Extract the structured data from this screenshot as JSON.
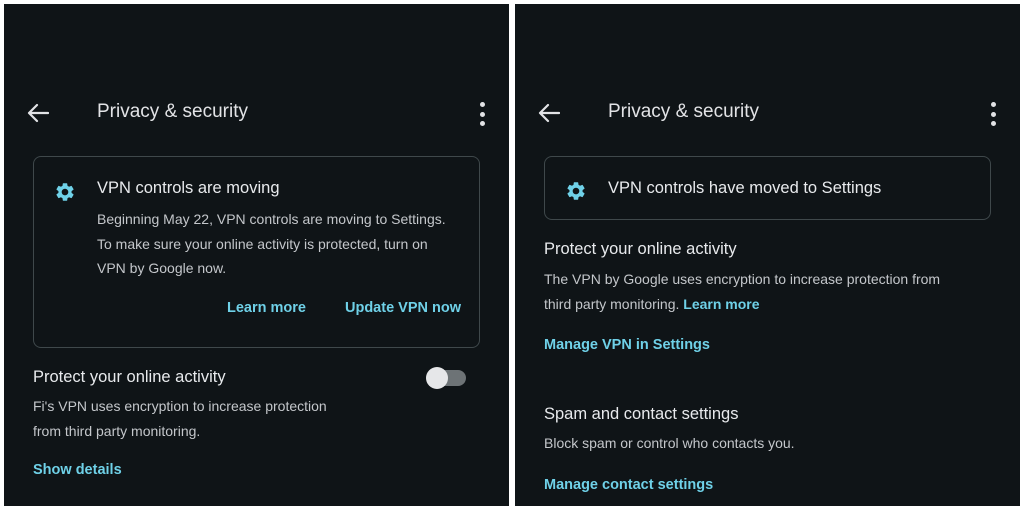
{
  "left": {
    "header": {
      "title": "Privacy & security"
    },
    "card": {
      "icon": "gear-icon",
      "title": "VPN controls are moving",
      "body_lines": [
        "Beginning May 22, VPN controls are moving to Settings.",
        "To make sure your online activity is protected, turn on",
        "VPN by Google now."
      ],
      "learn_more": "Learn more",
      "update": "Update VPN now"
    },
    "protect": {
      "title": "Protect your online activity",
      "desc_lines": [
        "Fi's VPN uses encryption to increase protection",
        "from third party monitoring."
      ],
      "toggle_on": false,
      "show_details": "Show details"
    }
  },
  "right": {
    "header": {
      "title": "Privacy & security"
    },
    "banner": {
      "icon": "gear-icon",
      "title": "VPN controls have moved to Settings"
    },
    "protect": {
      "title": "Protect your online activity",
      "desc_line1": "The VPN by Google uses encryption to increase protection from",
      "desc_line2": "third party monitoring.",
      "learn_more": "Learn more",
      "manage": "Manage VPN in Settings"
    },
    "spam": {
      "title": "Spam and contact settings",
      "desc": "Block spam or control who contacts you.",
      "manage": "Manage contact settings"
    }
  },
  "colors": {
    "background": "#0f1417",
    "accent": "#6fd1e8",
    "text": "#e2e3e6",
    "secondary_text": "#c4c7cb",
    "outline": "#3f484b"
  }
}
